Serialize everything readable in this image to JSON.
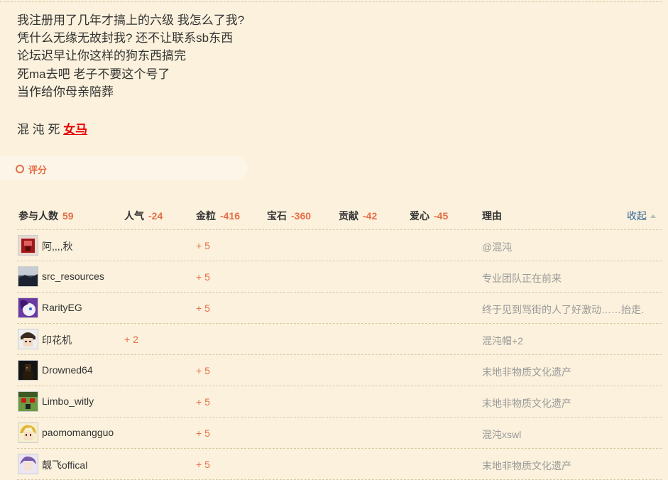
{
  "post": {
    "lines": [
      "我注册用了几年才搞上的六级 我怎么了我?",
      "凭什么无缘无故封我? 还不让联系sb东西",
      "论坛迟早让你这样的狗东西搞完",
      "死ma去吧 老子不要这个号了",
      "当作给你母亲陪葬"
    ],
    "signature": {
      "prefix": "混 沌 死",
      "emphasis": "女马"
    }
  },
  "rating": {
    "button_label": "评分",
    "colors": {
      "accent": "#e86d47",
      "link": "#336699",
      "muted": "#999999",
      "background": "#fbf1dc"
    },
    "header": {
      "participants_label": "参与人数",
      "participants_value": "59",
      "popularity_label": "人气",
      "popularity_value": "-24",
      "gold_label": "金粒",
      "gold_value": "-416",
      "gem_label": "宝石",
      "gem_value": "-360",
      "contrib_label": "贡献",
      "contrib_value": "-42",
      "love_label": "爱心",
      "love_value": "-45",
      "reason_label": "理由",
      "collapse_label": "收起"
    },
    "rows": [
      {
        "user": "阿,,,,秋",
        "popularity": "",
        "gold": "+ 5",
        "reason": "@混沌",
        "avatar_icon": "red-figure-avatar"
      },
      {
        "user": "src_resources",
        "popularity": "",
        "gold": "+ 5",
        "reason": "专业团队正在前来",
        "avatar_icon": "night-landscape-avatar"
      },
      {
        "user": "RarityEG",
        "popularity": "",
        "gold": "+ 5",
        "reason": "终于见到骂街的人了好激动……抬走.",
        "avatar_icon": "purple-pony-avatar"
      },
      {
        "user": "印花机",
        "popularity": "+ 2",
        "gold": "",
        "reason": "混沌帽+2",
        "avatar_icon": "anime-boy-avatar"
      },
      {
        "user": "Drowned64",
        "popularity": "",
        "gold": "+ 5",
        "reason": "末地非物质文化遗产",
        "avatar_icon": "dark-figure-avatar"
      },
      {
        "user": "Limbo_witly",
        "popularity": "",
        "gold": "+ 5",
        "reason": "末地非物质文化遗产",
        "avatar_icon": "green-creeper-avatar"
      },
      {
        "user": "paomomangguo",
        "popularity": "",
        "gold": "+ 5",
        "reason": "混沌xswl",
        "avatar_icon": "yellow-anime-avatar"
      },
      {
        "user": "靓飞offical",
        "popularity": "",
        "gold": "+ 5",
        "reason": "末地非物质文化遗产",
        "avatar_icon": "purple-anime-avatar"
      }
    ]
  }
}
